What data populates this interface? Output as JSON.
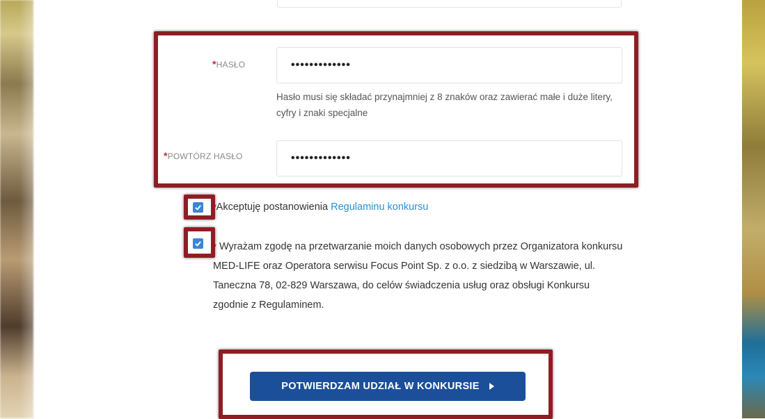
{
  "form": {
    "password": {
      "label": "HASŁO",
      "required_mark": "*",
      "value": "•••••••••••••",
      "hint": "Hasło musi się składać przynajmniej z 8 znaków oraz zawierać małe i duże litery, cyfry i znaki specjalne"
    },
    "password_repeat": {
      "label": "POWTÓRZ HASŁO",
      "required_mark": "*",
      "value": "•••••••••••••"
    },
    "terms": {
      "checked": true,
      "required_mark": "*",
      "text": "Akceptuję postanowienia ",
      "link_text": "Regulaminu konkursu"
    },
    "consent": {
      "checked": true,
      "required_mark": "*",
      "text": "Wyrażam zgodę na przetwarzanie moich danych osobowych przez Organizatora konkursu MED-LIFE oraz Operatora serwisu Focus Point Sp. z o.o. z siedzibą w Warszawie, ul. Taneczna 78, 02-829 Warszawa, do celów świadczenia usług oraz obsługi Konkursu zgodnie z Regulaminem."
    },
    "submit": {
      "label": "POTWIERDZAM UDZIAŁ W KONKURSIE",
      "icon": "caret-right-icon"
    }
  },
  "colors": {
    "highlight": "#8e1e24",
    "button": "#1c4f99",
    "checkbox": "#3a86d6",
    "link": "#2f8fd0",
    "required": "#c0282d"
  }
}
